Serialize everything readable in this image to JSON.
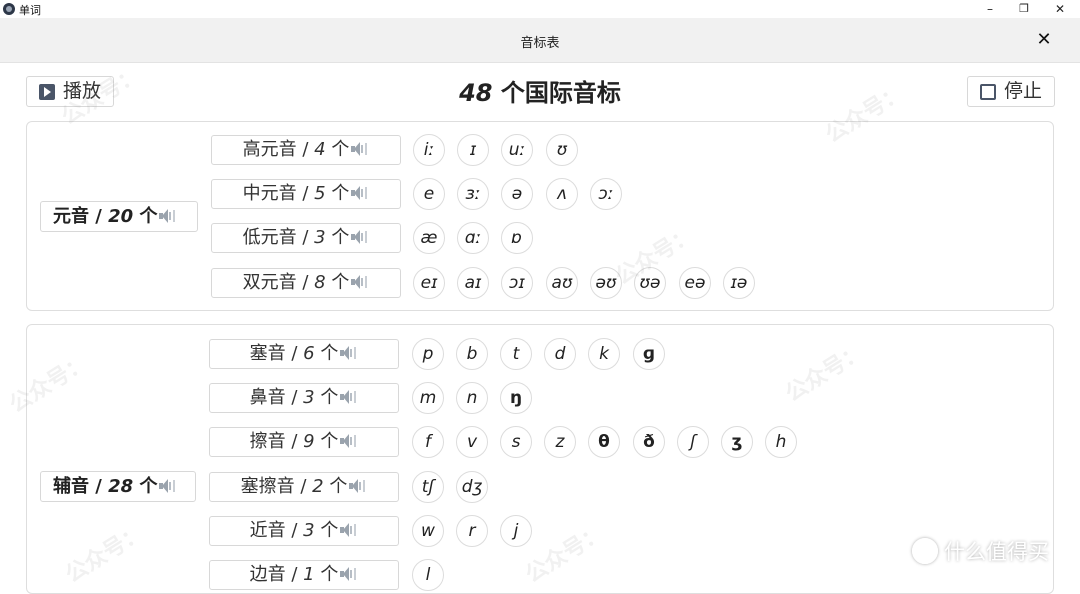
{
  "window": {
    "title": "单词",
    "minimize": "–",
    "restore": "❐",
    "close": "✕"
  },
  "header": {
    "title": "音标表",
    "close": "✕"
  },
  "toolbar": {
    "play_label": "播放",
    "stop_label": "停止",
    "title_num": "48",
    "title_text": " 个国际音标"
  },
  "vowels": {
    "label": "元音",
    "count": "20",
    "unit": "个",
    "groups": [
      {
        "name": "高元音",
        "count": "4",
        "unit": "个",
        "symbols": [
          "iː",
          "ɪ",
          "uː",
          "ʊ"
        ]
      },
      {
        "name": "中元音",
        "count": "5",
        "unit": "个",
        "symbols": [
          "e",
          "ɜː",
          "ə",
          "ʌ",
          "ɔː"
        ]
      },
      {
        "name": "低元音",
        "count": "3",
        "unit": "个",
        "symbols": [
          "æ",
          "ɑː",
          "ɒ"
        ]
      },
      {
        "name": "双元音",
        "count": "8",
        "unit": "个",
        "symbols": [
          "eɪ",
          "aɪ",
          "ɔɪ",
          "aʊ",
          "əʊ",
          "ʊə",
          "eə",
          "ɪə"
        ]
      }
    ]
  },
  "consonants": {
    "label": "辅音",
    "count": "28",
    "unit": "个",
    "groups": [
      {
        "name": "塞音",
        "count": "6",
        "unit": "个",
        "symbols": [
          "p",
          "b",
          "t",
          "d",
          "k",
          "ɡ"
        ]
      },
      {
        "name": "鼻音",
        "count": "3",
        "unit": "个",
        "symbols": [
          "m",
          "n",
          "ŋ"
        ]
      },
      {
        "name": "擦音",
        "count": "9",
        "unit": "个",
        "symbols": [
          "f",
          "v",
          "s",
          "z",
          "θ",
          "ð",
          "ʃ",
          "ʒ",
          "h"
        ]
      },
      {
        "name": "塞擦音",
        "count": "2",
        "unit": "个",
        "symbols": [
          "tʃ",
          "dʒ"
        ]
      },
      {
        "name": "近音",
        "count": "3",
        "unit": "个",
        "symbols": [
          "w",
          "r",
          "j"
        ]
      },
      {
        "name": "边音",
        "count": "1",
        "unit": "个",
        "symbols": [
          "l"
        ]
      }
    ]
  },
  "watermark": {
    "text": "公众号：",
    "brand": "什么值得买"
  }
}
